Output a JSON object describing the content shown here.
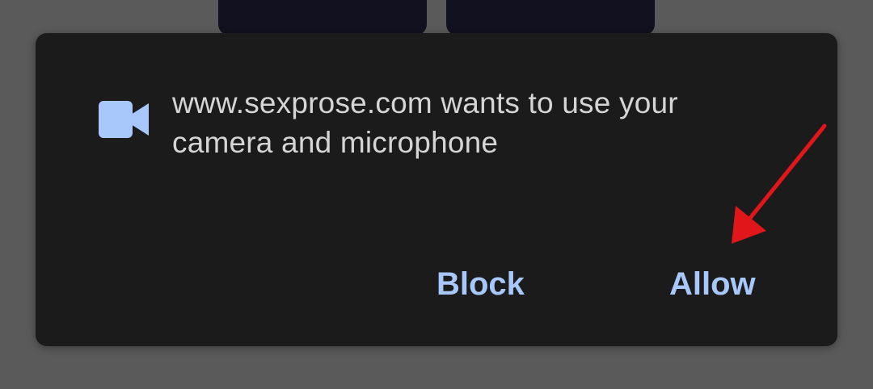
{
  "dialog": {
    "message": "www.sexprose.com wants to use your camera and microphone",
    "icon": "video-camera-icon",
    "buttons": {
      "block": "Block",
      "allow": "Allow"
    }
  },
  "colors": {
    "accent": "#a8c7fa",
    "dialog_bg": "#1b1b1b",
    "text": "#d5d5d5",
    "annotation_arrow": "#e0161b"
  }
}
